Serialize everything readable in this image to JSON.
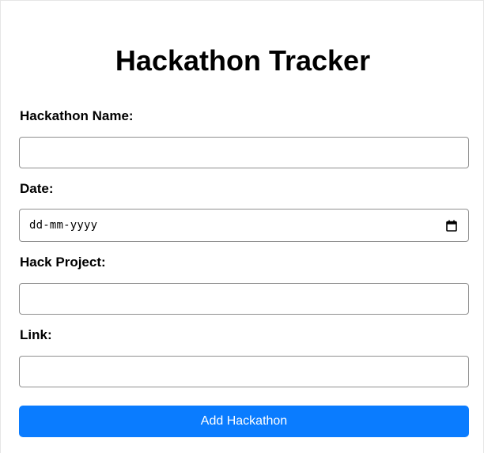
{
  "page": {
    "title": "Hackathon Tracker"
  },
  "form": {
    "name_label": "Hackathon Name:",
    "name_value": "",
    "date_label": "Date:",
    "date_placeholder": "dd-mm-yyyy",
    "date_icon": "calendar-icon",
    "project_label": "Hack Project:",
    "project_value": "",
    "link_label": "Link:",
    "link_value": "",
    "submit_label": "Add Hackathon"
  },
  "colors": {
    "accent": "#0a7cff",
    "input_border": "#8f8f8f",
    "text": "#000000",
    "background": "#ffffff"
  }
}
